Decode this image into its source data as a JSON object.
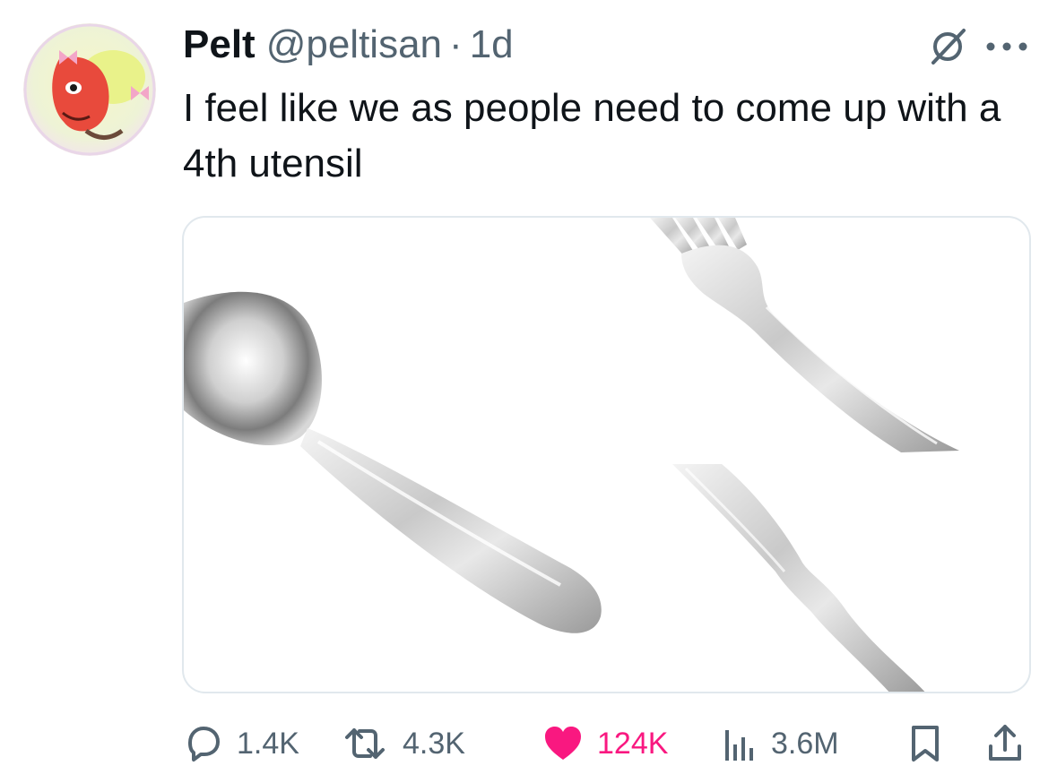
{
  "tweet": {
    "display_name": "Pelt",
    "handle": "@peltisan",
    "separator": "·",
    "time": "1d",
    "text": "I feel like we as people need to come up with a 4th utensil",
    "media_images": [
      "spoon",
      "fork",
      "knife"
    ]
  },
  "actions": {
    "replies": "1.4K",
    "reposts": "4.3K",
    "likes": "124K",
    "views": "3.6M"
  },
  "colors": {
    "like_active": "#f91880",
    "secondary_text": "#536471",
    "primary_text": "#0f1419"
  },
  "icons": [
    "grok-icon",
    "more-icon",
    "reply-icon",
    "repost-icon",
    "like-icon",
    "views-icon",
    "bookmark-icon",
    "share-icon"
  ]
}
